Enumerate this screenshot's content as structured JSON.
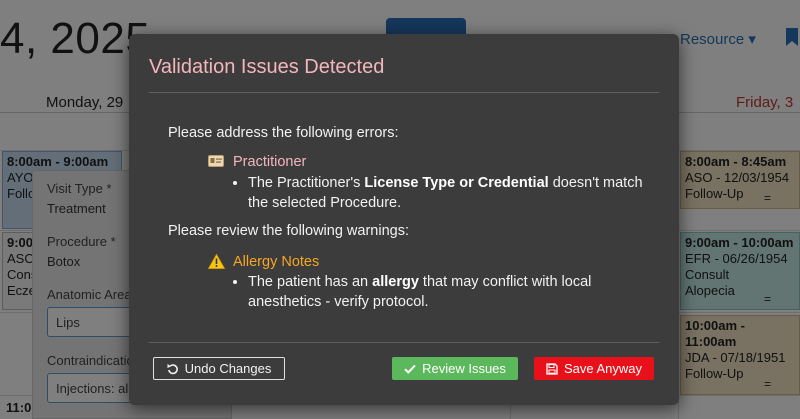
{
  "background": {
    "date_title": "4, 2025",
    "resource_label": "Resource ▾",
    "day_monday": "Monday, 29",
    "day_friday": "Friday, 3",
    "appointments": [
      {
        "time": "8:00am - 9:00am",
        "line2": "AYO",
        "line3": "Follo",
        "line4": ""
      },
      {
        "time": "9:00",
        "line2": "ASO",
        "line3": "Consul",
        "line4": "Eczem"
      },
      {
        "time": "8:00am - 8:45am",
        "line2": "ASO - 12/03/1954",
        "line3": "Follow-Up",
        "line4": ""
      },
      {
        "time": "9:00am - 10:00am",
        "line2": "EFR - 06/26/1954",
        "line3": "Consult",
        "line4": "Alopecia"
      },
      {
        "time": "10:00am - 11:00am",
        "line2": "JDA - 07/18/1951",
        "line3": "Follow-Up",
        "line4": ""
      }
    ],
    "appt_marker": "=",
    "side_panel": {
      "visit_type_label": "Visit Type *",
      "visit_type_value": "Treatment",
      "procedure_label": "Procedure *",
      "procedure_value": "Botox",
      "anatomic_label": "Anatomic Area",
      "anatomic_value": "Lips",
      "contra_label": "Contraindicatio",
      "contra_value": "Injections: all"
    },
    "time_left": "11:0"
  },
  "modal": {
    "title": "Validation Issues Detected",
    "errors_intro": "Please address the following errors:",
    "error_item": {
      "icon": "id-card-icon",
      "heading": "Practitioner",
      "text_pre": "The Practitioner's ",
      "text_bold": "License Type or Credential",
      "text_post": " doesn't match the selected Procedure."
    },
    "warnings_intro": "Please review the following warnings:",
    "warning_item": {
      "icon": "warning-icon",
      "heading": "Allergy Notes",
      "text_pre": "The patient has an ",
      "text_bold": "allergy",
      "text_post": " that may conflict with local anesthetics - verify protocol."
    },
    "buttons": {
      "undo": "Undo Changes",
      "review": "Review Issues",
      "save": "Save Anyway"
    }
  },
  "colors": {
    "title_pink": "#f4b6bd",
    "warning_orange": "#f5a623",
    "review_green": "#5cb85c",
    "save_red": "#e8111a"
  }
}
